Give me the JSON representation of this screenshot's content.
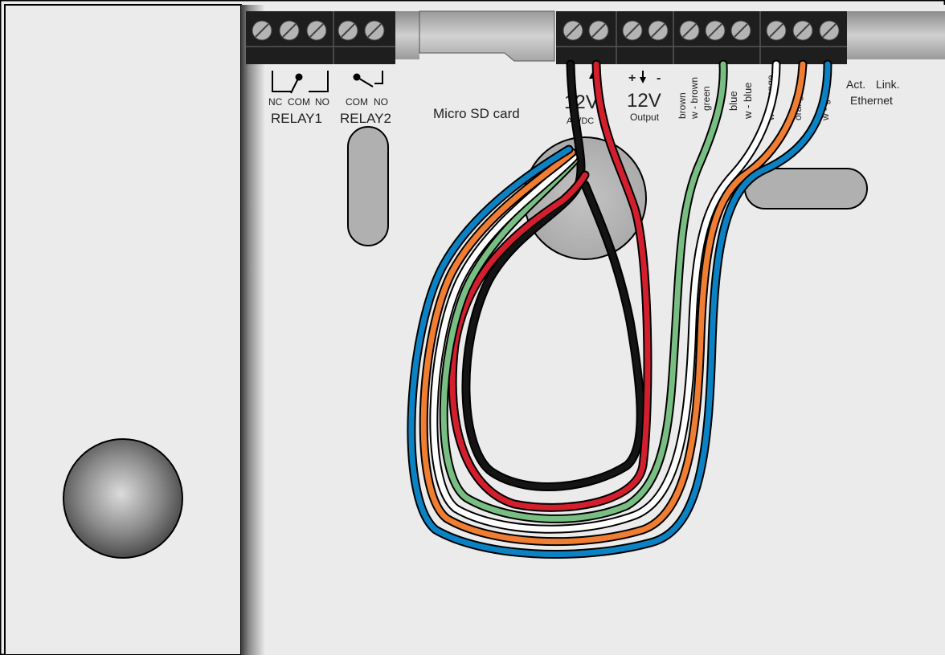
{
  "colors": {
    "enclosure": "#ebebeb",
    "terminal_block": "#1e1e1e",
    "screw": "#b4b4b4",
    "wire_black": "#141414",
    "wire_red": "#d21e2d",
    "wire_green": "#78be82",
    "wire_white": "#ffffff",
    "wire_orange": "#ef7d32",
    "wire_blue": "#0a82c3",
    "title_partial": "#1e6eb4"
  },
  "labels": {
    "relay1": {
      "nc": "NC",
      "com": "COM",
      "no": "NO",
      "name": "RELAY1"
    },
    "relay2": {
      "com": "COM",
      "no": "NO",
      "name": "RELAY2"
    },
    "micro_sd": "Micro SD card",
    "power_in": {
      "volt": "12V",
      "sub": "AC/DC"
    },
    "power_out": {
      "plus": "+",
      "minus": "-",
      "volt": "12V",
      "sub": "Output"
    },
    "ethernet": {
      "act": "Act.",
      "link": "Link.",
      "name": "Ethernet"
    },
    "wires": {
      "brown": "brown",
      "w_brown": "w - brown",
      "green": "green",
      "blue": "blue",
      "w_blue": "w - blue",
      "w_orange": "w - orange",
      "orange": "orange",
      "w_green": "w - green"
    }
  }
}
